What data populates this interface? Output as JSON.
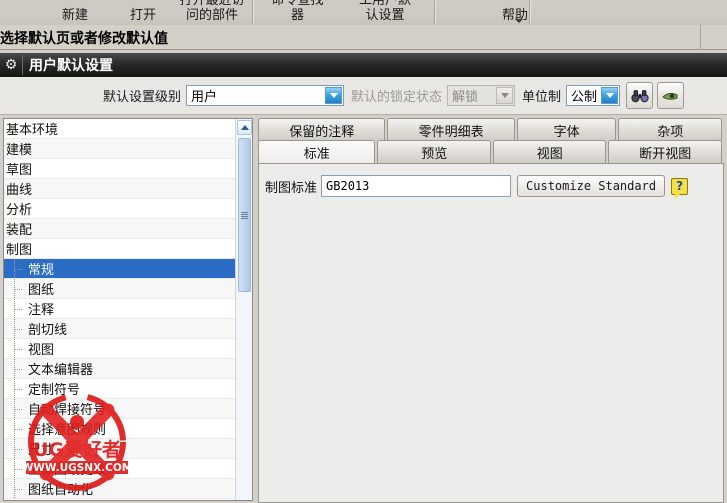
{
  "ribbon": {
    "groups": [
      {
        "label": "新建"
      },
      {
        "label": "打开"
      },
      {
        "label": "打开最近访\n问的部件"
      },
      {
        "label": "命令查找\n器"
      },
      {
        "label": "工用户默\n认设置"
      },
      {
        "label": "帮助"
      }
    ],
    "overflow_caret": "caret-down-icon"
  },
  "prompt": {
    "text": "选择默认页或者修改默认值"
  },
  "dialog": {
    "title": "用户默认设置",
    "title_icon": "gear-icon"
  },
  "controls": {
    "level_label": "默认设置级别",
    "level_value": "用户",
    "lock_label": "默认的锁定状态",
    "lock_value": "解锁",
    "units_label": "单位制",
    "units_value": "公制",
    "find_icon": "binoculars-icon",
    "second_icon": "view-icon"
  },
  "tree": {
    "items": [
      {
        "label": "基本环境",
        "level": 0,
        "selected": false
      },
      {
        "label": "建模",
        "level": 0,
        "selected": false
      },
      {
        "label": "草图",
        "level": 0,
        "selected": false
      },
      {
        "label": "曲线",
        "level": 0,
        "selected": false
      },
      {
        "label": "分析",
        "level": 0,
        "selected": false
      },
      {
        "label": "装配",
        "level": 0,
        "selected": false
      },
      {
        "label": "制图",
        "level": 0,
        "selected": false
      },
      {
        "label": "常规",
        "level": 1,
        "selected": true
      },
      {
        "label": "图纸",
        "level": 1,
        "selected": false
      },
      {
        "label": "注释",
        "level": 1,
        "selected": false
      },
      {
        "label": "剖切线",
        "level": 1,
        "selected": false
      },
      {
        "label": "视图",
        "level": 1,
        "selected": false
      },
      {
        "label": "文本编辑器",
        "level": 1,
        "selected": false
      },
      {
        "label": "定制符号",
        "level": 1,
        "selected": false
      },
      {
        "label": "自动焊接符号",
        "level": 1,
        "selected": false
      },
      {
        "label": "选择意图规则",
        "level": 1,
        "selected": false
      },
      {
        "label": "尺寸",
        "level": 1,
        "selected": false
      },
      {
        "label": "坐标图纸更改",
        "level": 1,
        "selected": false
      },
      {
        "label": "图纸自动化",
        "level": 1,
        "selected": false
      }
    ],
    "scrollbar": {
      "up_icon": "chevron-up-icon",
      "grip_icon": "grip-icon"
    }
  },
  "tabs_row1": [
    {
      "label": "保留的注释",
      "active": false
    },
    {
      "label": "零件明细表",
      "active": false
    },
    {
      "label": "字体",
      "active": false
    },
    {
      "label": "杂项",
      "active": false
    }
  ],
  "tabs_row2": [
    {
      "label": "标准",
      "active": true
    },
    {
      "label": "预览",
      "active": false
    },
    {
      "label": "视图",
      "active": false
    },
    {
      "label": "断开视图",
      "active": false
    }
  ],
  "panel": {
    "standard_label": "制图标准",
    "standard_value": "GB2013",
    "customize_button": "Customize Standard",
    "help_icon": "help-question-icon",
    "help_glyph": "?"
  },
  "watermark": {
    "brand": "UG爱好者",
    "url": "WWW.UGSNX.COM",
    "color": "#e01b1b"
  },
  "colors": {
    "selection": "#2b6cc4",
    "titlebar": "#141414",
    "chrome": "#d4d0c8",
    "accent_blue": "#3f9fe0"
  }
}
